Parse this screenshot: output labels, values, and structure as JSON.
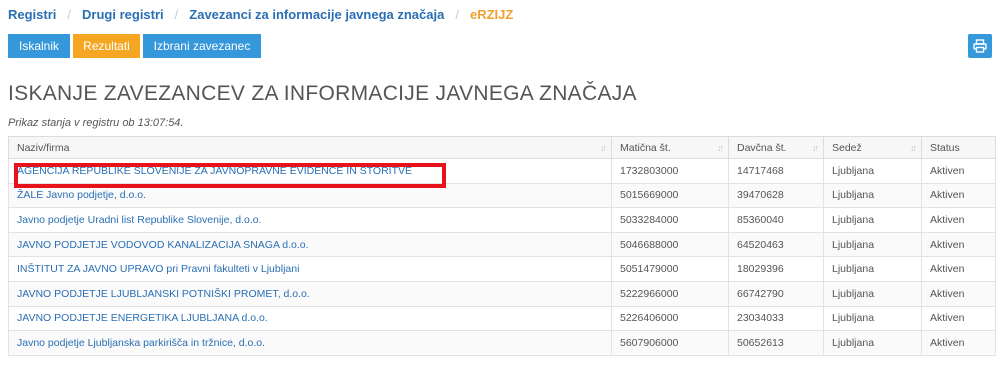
{
  "breadcrumb": {
    "items": [
      "Registri",
      "Drugi registri",
      "Zavezanci za informacije javnega značaja",
      "eRZIJZ"
    ],
    "separator": "/"
  },
  "tabs": [
    "Iskalnik",
    "Rezultati",
    "Izbrani zavezanec"
  ],
  "print_icon": "printer-icon",
  "title": "ISKANJE ZAVEZANCEV ZA INFORMACIJE JAVNEGA ZNAČAJA",
  "snapshot_text": "Prikaz stanja v registru ob 13:07:54.",
  "table": {
    "columns": [
      "Naziv/firma",
      "Matična št.",
      "Davčna št.",
      "Sedež",
      "Status"
    ],
    "rows": [
      [
        "AGENCIJA REPUBLIKE SLOVENIJE ZA JAVNOPRAVNE EVIDENCE IN STORITVE",
        "1732803000",
        "14717468",
        "Ljubljana",
        "Aktiven"
      ],
      [
        "ŽALE Javno podjetje, d.o.o.",
        "5015669000",
        "39470628",
        "Ljubljana",
        "Aktiven"
      ],
      [
        "Javno podjetje Uradni list Republike Slovenije, d.o.o.",
        "5033284000",
        "85360040",
        "Ljubljana",
        "Aktiven"
      ],
      [
        "JAVNO PODJETJE VODOVOD KANALIZACIJA SNAGA d.o.o.",
        "5046688000",
        "64520463",
        "Ljubljana",
        "Aktiven"
      ],
      [
        "INŠTITUT ZA JAVNO UPRAVO pri Pravni fakulteti v Ljubljani",
        "5051479000",
        "18029396",
        "Ljubljana",
        "Aktiven"
      ],
      [
        "JAVNO PODJETJE LJUBLJANSKI POTNIŠKI PROMET, d.o.o.",
        "5222966000",
        "66742790",
        "Ljubljana",
        "Aktiven"
      ],
      [
        "JAVNO PODJETJE ENERGETIKA LJUBLJANA d.o.o.",
        "5226406000",
        "23034033",
        "Ljubljana",
        "Aktiven"
      ],
      [
        "Javno podjetje Ljubljanska parkirišča in tržnice, d.o.o.",
        "5607906000",
        "50652613",
        "Ljubljana",
        "Aktiven"
      ]
    ]
  },
  "colors": {
    "link": "#2a6fb4",
    "tab_blue": "#3498db",
    "tab_active": "#f5a623",
    "highlight": "#e8131a"
  }
}
